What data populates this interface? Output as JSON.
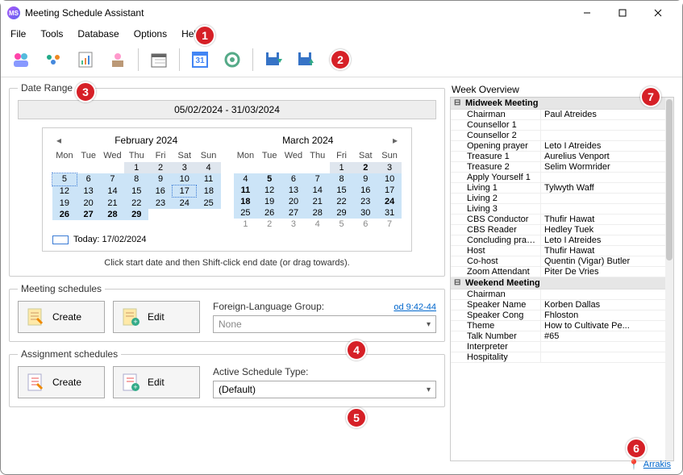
{
  "window": {
    "title": "Meeting Schedule Assistant"
  },
  "menu": {
    "file": "File",
    "tools": "Tools",
    "database": "Database",
    "options": "Options",
    "help": "Help"
  },
  "daterange": {
    "legend": "Date Range",
    "header": "05/02/2024 - 31/03/2024",
    "month1": "February 2024",
    "month2": "March 2024",
    "dow": [
      "Mon",
      "Tue",
      "Wed",
      "Thu",
      "Fri",
      "Sat",
      "Sun"
    ],
    "today": "Today: 17/02/2024",
    "hint": "Click start date and then Shift-click end date (or drag towards).",
    "feb": [
      [
        "",
        "",
        "",
        "1",
        "2",
        "3",
        "4"
      ],
      [
        "5",
        "6",
        "7",
        "8",
        "9",
        "10",
        "11"
      ],
      [
        "12",
        "13",
        "14",
        "15",
        "16",
        "17",
        "18"
      ],
      [
        "19",
        "20",
        "21",
        "22",
        "23",
        "24",
        "25"
      ],
      [
        "26",
        "27",
        "28",
        "29",
        "",
        "",
        ""
      ],
      [
        "",
        "",
        "",
        "",
        "",
        "",
        ""
      ]
    ],
    "mar": [
      [
        "",
        "",
        "",
        "",
        "1",
        "2",
        "3"
      ],
      [
        "4",
        "5",
        "6",
        "7",
        "8",
        "9",
        "10"
      ],
      [
        "11",
        "12",
        "13",
        "14",
        "15",
        "16",
        "17"
      ],
      [
        "18",
        "19",
        "20",
        "21",
        "22",
        "23",
        "24"
      ],
      [
        "25",
        "26",
        "27",
        "28",
        "29",
        "30",
        "31"
      ],
      [
        "1",
        "2",
        "3",
        "4",
        "5",
        "6",
        "7"
      ]
    ]
  },
  "meeting_schedules": {
    "legend": "Meeting schedules",
    "create": "Create",
    "edit": "Edit",
    "fg_label": "Foreign-Language Group:",
    "fg_value": "None",
    "link": "od 9:42-44"
  },
  "assignment_schedules": {
    "legend": "Assignment schedules",
    "create": "Create",
    "edit": "Edit",
    "active_label": "Active Schedule Type:",
    "active_value": "(Default)"
  },
  "overview": {
    "label": "Week Overview",
    "midweek_header": "Midweek Meeting",
    "weekend_header": "Weekend Meeting",
    "midweek": [
      [
        "Chairman",
        "Paul Atreides"
      ],
      [
        "Counsellor 1",
        ""
      ],
      [
        "Counsellor 2",
        ""
      ],
      [
        "Opening prayer",
        "Leto I Atreides"
      ],
      [
        "Treasure 1",
        "Aurelius Venport"
      ],
      [
        "Treasure 2",
        "Selim Wormrider"
      ],
      [
        "Apply Yourself 1",
        ""
      ],
      [
        "Living 1",
        "Tylwyth Waff"
      ],
      [
        "Living 2",
        ""
      ],
      [
        "Living 3",
        ""
      ],
      [
        "CBS Conductor",
        "Thufir Hawat"
      ],
      [
        "CBS Reader",
        "Hedley Tuek"
      ],
      [
        "Concluding prayer",
        "Leto I Atreides"
      ],
      [
        "Host",
        "Thufir Hawat"
      ],
      [
        "Co-host",
        "Quentin (Vigar) Butler"
      ],
      [
        "Zoom Attendant",
        "Piter De Vries"
      ]
    ],
    "weekend": [
      [
        "Chairman",
        ""
      ],
      [
        "Speaker Name",
        "Korben Dallas"
      ],
      [
        "Speaker Cong",
        "Fhloston"
      ],
      [
        "Theme",
        "How to Cultivate Pe..."
      ],
      [
        "Talk Number",
        "#65"
      ],
      [
        "Interpreter",
        ""
      ],
      [
        "Hospitality",
        ""
      ]
    ]
  },
  "status": {
    "location": "Arrakis"
  },
  "badges": [
    "1",
    "2",
    "3",
    "4",
    "5",
    "6",
    "7"
  ]
}
